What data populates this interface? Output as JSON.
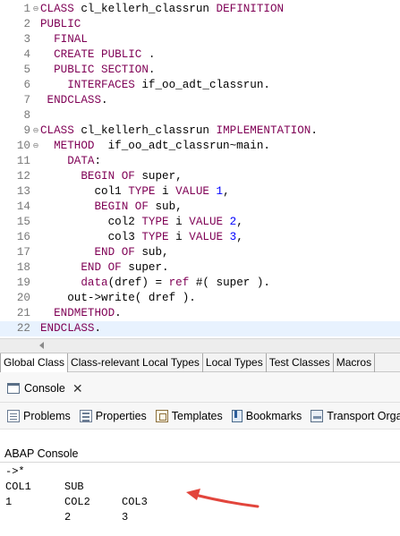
{
  "editor": {
    "lines": [
      {
        "num": "1",
        "fold": "⊖",
        "current": false,
        "tokens": [
          {
            "t": "CLASS",
            "c": "kw"
          },
          {
            "t": " cl_kellerh_classrun ",
            "c": "plain"
          },
          {
            "t": "DEFINITION",
            "c": "kw"
          }
        ]
      },
      {
        "num": "2",
        "fold": "",
        "current": false,
        "tokens": [
          {
            "t": "PUBLIC",
            "c": "kw"
          }
        ]
      },
      {
        "num": "3",
        "fold": "",
        "current": false,
        "tokens": [
          {
            "t": "  FINAL",
            "c": "kw"
          }
        ]
      },
      {
        "num": "4",
        "fold": "",
        "current": false,
        "tokens": [
          {
            "t": "  CREATE PUBLIC",
            "c": "kw"
          },
          {
            "t": " .",
            "c": "plain"
          }
        ]
      },
      {
        "num": "5",
        "fold": "",
        "current": false,
        "tokens": [
          {
            "t": "  PUBLIC SECTION",
            "c": "kw"
          },
          {
            "t": ".",
            "c": "plain"
          }
        ]
      },
      {
        "num": "6",
        "fold": "",
        "current": false,
        "tokens": [
          {
            "t": "    INTERFACES",
            "c": "kw"
          },
          {
            "t": " if_oo_adt_classrun.",
            "c": "plain"
          }
        ]
      },
      {
        "num": "7",
        "fold": "",
        "current": false,
        "tokens": [
          {
            "t": " ENDCLASS",
            "c": "kw"
          },
          {
            "t": ".",
            "c": "plain"
          }
        ]
      },
      {
        "num": "8",
        "fold": "",
        "current": false,
        "tokens": []
      },
      {
        "num": "9",
        "fold": "⊖",
        "current": false,
        "tokens": [
          {
            "t": "CLASS",
            "c": "kw"
          },
          {
            "t": " cl_kellerh_classrun ",
            "c": "plain"
          },
          {
            "t": "IMPLEMENTATION",
            "c": "kw"
          },
          {
            "t": ".",
            "c": "plain"
          }
        ]
      },
      {
        "num": "10",
        "fold": "⊖",
        "current": false,
        "tokens": [
          {
            "t": "  METHOD",
            "c": "kw"
          },
          {
            "t": "  if_oo_adt_classrun~main.",
            "c": "plain"
          }
        ]
      },
      {
        "num": "11",
        "fold": "",
        "current": false,
        "tokens": [
          {
            "t": "    DATA",
            "c": "kw"
          },
          {
            "t": ":",
            "c": "plain"
          }
        ]
      },
      {
        "num": "12",
        "fold": "",
        "current": false,
        "tokens": [
          {
            "t": "      BEGIN OF",
            "c": "kw"
          },
          {
            "t": " super,",
            "c": "plain"
          }
        ]
      },
      {
        "num": "13",
        "fold": "",
        "current": false,
        "tokens": [
          {
            "t": "        col1 ",
            "c": "plain"
          },
          {
            "t": "TYPE",
            "c": "kw"
          },
          {
            "t": " i ",
            "c": "plain"
          },
          {
            "t": "VALUE",
            "c": "kw"
          },
          {
            "t": " ",
            "c": "plain"
          },
          {
            "t": "1",
            "c": "num"
          },
          {
            "t": ",",
            "c": "plain"
          }
        ]
      },
      {
        "num": "14",
        "fold": "",
        "current": false,
        "tokens": [
          {
            "t": "        BEGIN OF",
            "c": "kw"
          },
          {
            "t": " sub,",
            "c": "plain"
          }
        ]
      },
      {
        "num": "15",
        "fold": "",
        "current": false,
        "tokens": [
          {
            "t": "          col2 ",
            "c": "plain"
          },
          {
            "t": "TYPE",
            "c": "kw"
          },
          {
            "t": " i ",
            "c": "plain"
          },
          {
            "t": "VALUE",
            "c": "kw"
          },
          {
            "t": " ",
            "c": "plain"
          },
          {
            "t": "2",
            "c": "num"
          },
          {
            "t": ",",
            "c": "plain"
          }
        ]
      },
      {
        "num": "16",
        "fold": "",
        "current": false,
        "tokens": [
          {
            "t": "          col3 ",
            "c": "plain"
          },
          {
            "t": "TYPE",
            "c": "kw"
          },
          {
            "t": " i ",
            "c": "plain"
          },
          {
            "t": "VALUE",
            "c": "kw"
          },
          {
            "t": " ",
            "c": "plain"
          },
          {
            "t": "3",
            "c": "num"
          },
          {
            "t": ",",
            "c": "plain"
          }
        ]
      },
      {
        "num": "17",
        "fold": "",
        "current": false,
        "tokens": [
          {
            "t": "        END OF",
            "c": "kw"
          },
          {
            "t": " sub,",
            "c": "plain"
          }
        ]
      },
      {
        "num": "18",
        "fold": "",
        "current": false,
        "tokens": [
          {
            "t": "      END OF",
            "c": "kw"
          },
          {
            "t": " super.",
            "c": "plain"
          }
        ]
      },
      {
        "num": "19",
        "fold": "",
        "current": false,
        "tokens": [
          {
            "t": "      data",
            "c": "kw"
          },
          {
            "t": "(dref) = ",
            "c": "plain"
          },
          {
            "t": "ref",
            "c": "kw"
          },
          {
            "t": " #( super ).",
            "c": "plain"
          }
        ]
      },
      {
        "num": "20",
        "fold": "",
        "current": false,
        "tokens": [
          {
            "t": "    out->write( dref ).",
            "c": "plain"
          }
        ]
      },
      {
        "num": "21",
        "fold": "",
        "current": false,
        "tokens": [
          {
            "t": "  ENDMETHOD",
            "c": "kw"
          },
          {
            "t": ".",
            "c": "plain"
          }
        ]
      },
      {
        "num": "22",
        "fold": "",
        "current": true,
        "tokens": [
          {
            "t": "ENDCLASS",
            "c": "kw"
          },
          {
            "t": ".",
            "c": "plain"
          }
        ]
      }
    ]
  },
  "bottom_tabs": [
    {
      "label": "Global Class",
      "active": true
    },
    {
      "label": "Class-relevant Local Types",
      "active": false
    },
    {
      "label": "Local Types",
      "active": false
    },
    {
      "label": "Test Classes",
      "active": false
    },
    {
      "label": "Macros",
      "active": false
    }
  ],
  "console_view": {
    "tab_label": "Console",
    "close_glyph": "✕",
    "toolbar": [
      {
        "label": "Problems",
        "icon": "problems-icon"
      },
      {
        "label": "Properties",
        "icon": "properties-icon"
      },
      {
        "label": "Templates",
        "icon": "templates-icon"
      },
      {
        "label": "Bookmarks",
        "icon": "bookmarks-icon"
      },
      {
        "label": "Transport Orga",
        "icon": "transport-organizer-icon"
      }
    ],
    "title": "ABAP Console",
    "output": {
      "line1": "->*",
      "header_col1": "COL1",
      "header_sub": "SUB",
      "row1_col1": "1",
      "row1_col2_header": "COL2",
      "row1_col3_header": "COL3",
      "row2_col2": "2",
      "row2_col3": "3"
    }
  },
  "colors": {
    "keyword": "#7f0055",
    "number": "#0000ff",
    "annotation_arrow": "#e2453c"
  }
}
